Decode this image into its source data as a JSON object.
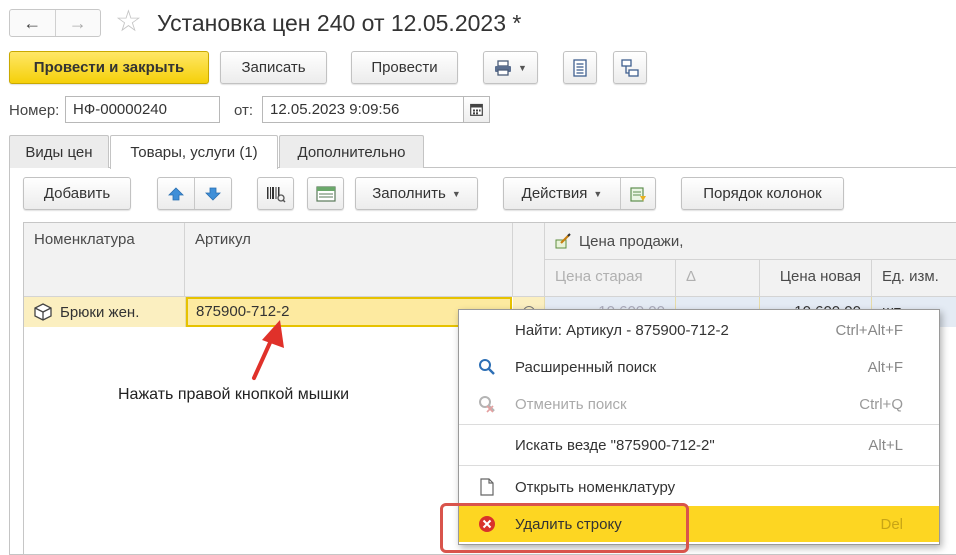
{
  "header": {
    "title": "Установка цен 240 от 12.05.2023 *"
  },
  "toolbar": {
    "post_close": "Провести и закрыть",
    "save": "Записать",
    "post": "Провести"
  },
  "doc": {
    "number_label": "Номер:",
    "number_value": "НФ-00000240",
    "date_label": "от:",
    "date_value": "12.05.2023  9:09:56"
  },
  "tabs": [
    {
      "label": "Виды цен"
    },
    {
      "label": "Товары, услуги (1)"
    },
    {
      "label": "Дополнительно"
    }
  ],
  "table_toolbar": {
    "add": "Добавить",
    "fill": "Заполнить",
    "actions": "Действия",
    "column_order": "Порядок колонок"
  },
  "grid": {
    "headers": {
      "nomenclature": "Номенклатура",
      "article": "Артикул",
      "sale_price": "Цена продажи,",
      "old_price": "Цена старая",
      "delta": "Δ",
      "new_price": "Цена новая",
      "unit": "Ед. изм."
    },
    "row": {
      "nomenclature": "Брюки жен.",
      "article": "875900-712-2",
      "old_price": "10 600,00",
      "new_price": "10 600,00",
      "unit": "шт"
    }
  },
  "context_menu": {
    "items": [
      {
        "label": "Найти: Артикул - 875900-712-2",
        "shortcut": "Ctrl+Alt+F"
      },
      {
        "label": "Расширенный поиск",
        "shortcut": "Alt+F"
      },
      {
        "label": "Отменить поиск",
        "shortcut": "Ctrl+Q"
      },
      {
        "label": "Искать везде \"875900-712-2\"",
        "shortcut": "Alt+L"
      },
      {
        "label": "Открыть номенклатуру",
        "shortcut": ""
      },
      {
        "label": "Удалить строку",
        "shortcut": "Del"
      }
    ]
  },
  "annotation": {
    "hint": "Нажать правой кнопкой мышки"
  },
  "colors": {
    "primary_button": "#f5d009",
    "menu_highlight": "#fdd622",
    "annotation_red": "#d9544c"
  }
}
